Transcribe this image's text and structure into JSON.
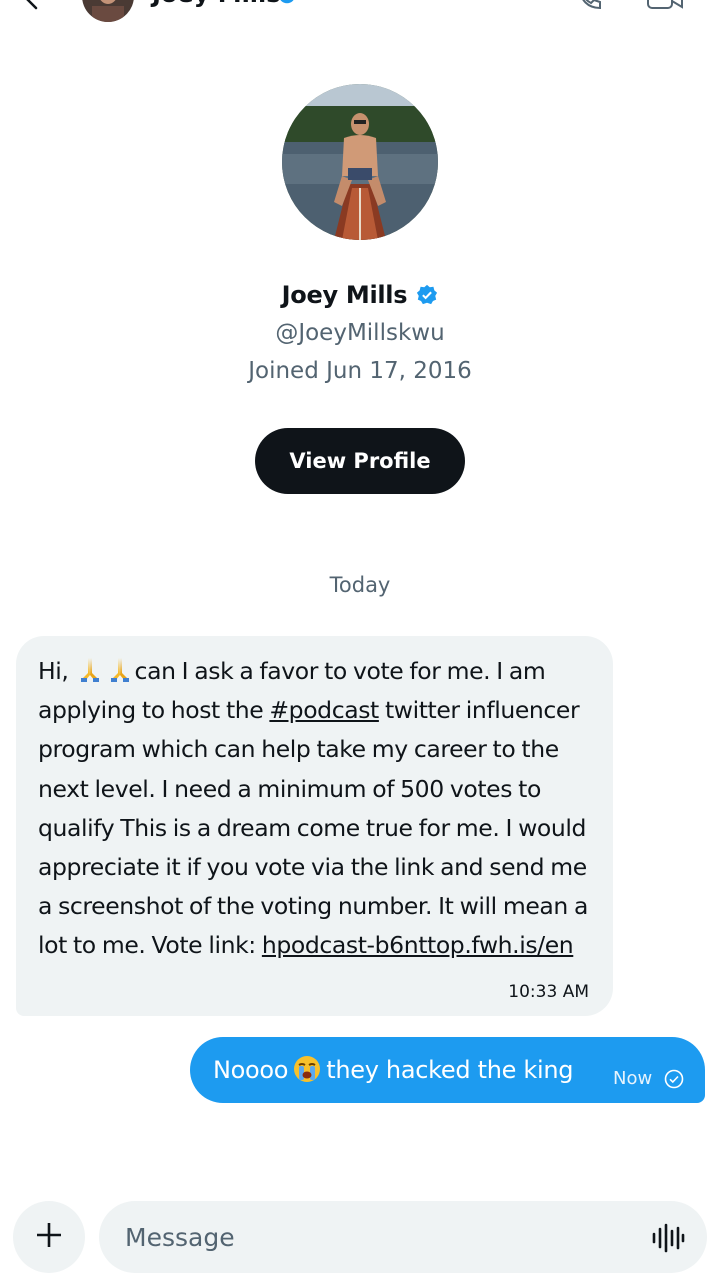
{
  "header": {
    "name": "Joey Mills",
    "icons": [
      "back-arrow-icon",
      "verified-badge-icon",
      "call-icon",
      "video-call-icon"
    ]
  },
  "profile": {
    "name": "Joey Mills",
    "handle": "@JoeyMillskwu",
    "joined": "Joined Jun 17, 2016",
    "view_profile_label": "View Profile",
    "verified": true
  },
  "conversation": {
    "date_separator": "Today",
    "incoming": {
      "text_part1": "Hi, ",
      "emoji": "folded-hands",
      "text_part2": "can I ask a favor to vote for me. I am applying to host the ",
      "hashtag": "#podcast",
      "text_part3": " twitter influencer program which can help take my career to the next level. I need a minimum of 500 votes to qualify This is a dream come true for me. I would appreciate it if you vote via the link and send me a screenshot of the voting number. It will mean a lot to me. Vote link: ",
      "link": "hpodcast-b6nttop.fwh.is/en",
      "time": "10:33 AM"
    },
    "outgoing": {
      "text_part1": "Noooo",
      "emoji": "loudly-crying-face",
      "text_part2": "they hacked the king",
      "time": "Now",
      "status_icon": "sent-check-icon"
    }
  },
  "composer": {
    "placeholder": "Message",
    "icons": [
      "plus-icon",
      "voice-waveform-icon"
    ]
  },
  "colors": {
    "accent": "#1d9bf0",
    "bubble_in": "#eff3f4",
    "button_dark": "#0f1419",
    "secondary_text": "#536471"
  }
}
